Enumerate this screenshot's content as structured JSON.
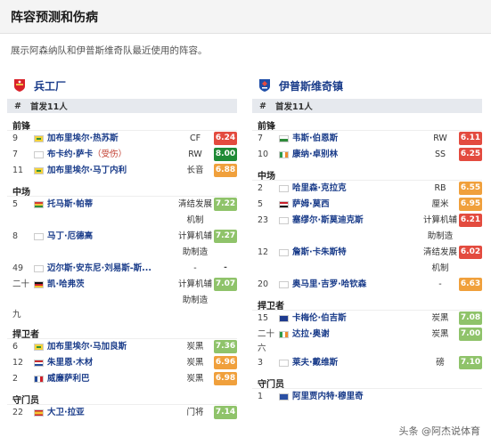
{
  "header": {
    "title": "阵容预测和伤病"
  },
  "subtitle": "展示阿森纳队和伊普斯维奇队最近使用的阵容。",
  "lineup_label": "首发11人",
  "watermark": "头条 @阿杰说体育",
  "colors": {
    "red": "#d9423a",
    "green": "#2e8b3a",
    "lightgreen": "#8fc36a",
    "orange": "#e89a3c"
  },
  "left": {
    "team": "兵工厂",
    "logo_icon": "arsenal-crest-icon",
    "groups": [
      {
        "label": "前锋",
        "players": [
          {
            "num": "9",
            "name": "加布里埃尔·热苏斯",
            "pos": "CF",
            "rating": "6.24",
            "color": "#e34b3f",
            "flag": "brazil"
          },
          {
            "num": "7",
            "name": "布卡约·萨卡",
            "injury": "（受伤）",
            "pos": "RW",
            "rating": "8.00",
            "color": "#1f8a36",
            "flag": "england"
          },
          {
            "num": "11",
            "name": "加布里埃尔·马丁内利",
            "pos": "长音",
            "rating": "6.88",
            "color": "#f0a03c",
            "flag": "brazil"
          }
        ]
      },
      {
        "label": "中场",
        "players": [
          {
            "num": "5",
            "name": "托马斯·帕蒂",
            "pos": "清结发展",
            "pos2": "机制",
            "rating": "7.22",
            "color": "#8fc36a",
            "flag": "ghana"
          },
          {
            "num": "8",
            "name": "马丁·厄德高",
            "pos": "计算机辅",
            "pos2": "助制造",
            "rating": "7.27",
            "color": "#8fc36a",
            "flag": "norway"
          },
          {
            "num": "49",
            "name": "迈尔斯·安东尼·刘易斯-斯...",
            "pos": "-",
            "rating": "-",
            "color": "",
            "flag": "england"
          },
          {
            "num": "二十",
            "num2": "九",
            "name": "凯·哈弗茨",
            "pos": "计算机辅",
            "pos2": "助制造",
            "rating": "7.07",
            "color": "#8fc36a",
            "flag": "germany"
          }
        ]
      },
      {
        "label": "捍卫者",
        "players": [
          {
            "num": "6",
            "name": "加布里埃尔·马加良斯",
            "pos": "炭黑",
            "rating": "7.36",
            "color": "#8fc36a",
            "flag": "brazil"
          },
          {
            "num": "12",
            "name": "朱里恩·木材",
            "pos": "炭黑",
            "rating": "6.96",
            "color": "#f0a03c",
            "flag": "netherlands"
          },
          {
            "num": "2",
            "name": "威廉萨利巴",
            "pos": "炭黑",
            "rating": "6.98",
            "color": "#f0a03c",
            "flag": "france"
          }
        ]
      },
      {
        "label": "守门员",
        "players": [
          {
            "num": "22",
            "name": "大卫·拉亚",
            "pos": "门将",
            "rating": "7.14",
            "color": "#8fc36a",
            "flag": "spain"
          }
        ]
      }
    ]
  },
  "right": {
    "team": "伊普斯维奇镇",
    "logo_icon": "ipswich-crest-icon",
    "groups": [
      {
        "label": "前锋",
        "players": [
          {
            "num": "7",
            "name": "韦斯·伯恩斯",
            "pos": "RW",
            "rating": "6.11",
            "color": "#e34b3f",
            "flag": "wales"
          },
          {
            "num": "10",
            "name": "康纳·卓别林",
            "pos": "SS",
            "rating": "6.25",
            "color": "#e34b3f",
            "flag": "ireland"
          }
        ]
      },
      {
        "label": "中场",
        "players": [
          {
            "num": "2",
            "name": "哈里森·克拉克",
            "pos": "RB",
            "rating": "6.55",
            "color": "#f0a03c",
            "flag": "england"
          },
          {
            "num": "5",
            "name": "萨姆·莫西",
            "pos": "厘米",
            "rating": "6.95",
            "color": "#f0a03c",
            "flag": "egypt"
          },
          {
            "num": "23",
            "name": "塞缪尔·斯莫迪克斯",
            "pos": "计算机辅",
            "pos2": "助制造",
            "rating": "6.21",
            "color": "#e34b3f",
            "flag": "norway"
          },
          {
            "num": "12",
            "name": "詹斯·卡朱斯特",
            "pos": "清结发展",
            "pos2": "机制",
            "rating": "6.02",
            "color": "#e34b3f",
            "flag": "denmark"
          },
          {
            "num": "20",
            "name": "奥马里·吉罗·哈钦森",
            "pos": "-",
            "rating": "6.63",
            "color": "#f0a03c",
            "flag": "jamaica"
          }
        ]
      },
      {
        "label": "捍卫者",
        "players": [
          {
            "num": "15",
            "name": "卡梅伦·伯吉斯",
            "pos": "炭黑",
            "rating": "7.08",
            "color": "#8fc36a",
            "flag": "australia"
          },
          {
            "num": "二十",
            "num2": "六",
            "name": "达拉·奥谢",
            "pos": "炭黑",
            "rating": "7.00",
            "color": "#8fc36a",
            "flag": "ireland"
          },
          {
            "num": "3",
            "name": "莱夫·戴维斯",
            "pos": "磅",
            "rating": "7.10",
            "color": "#8fc36a",
            "flag": "england"
          }
        ]
      },
      {
        "label": "守门员",
        "players": [
          {
            "num": "1",
            "name": "阿里贾内特·穆里奇",
            "pos": "",
            "rating": "",
            "color": "",
            "flag": "kosovo"
          }
        ]
      }
    ]
  }
}
